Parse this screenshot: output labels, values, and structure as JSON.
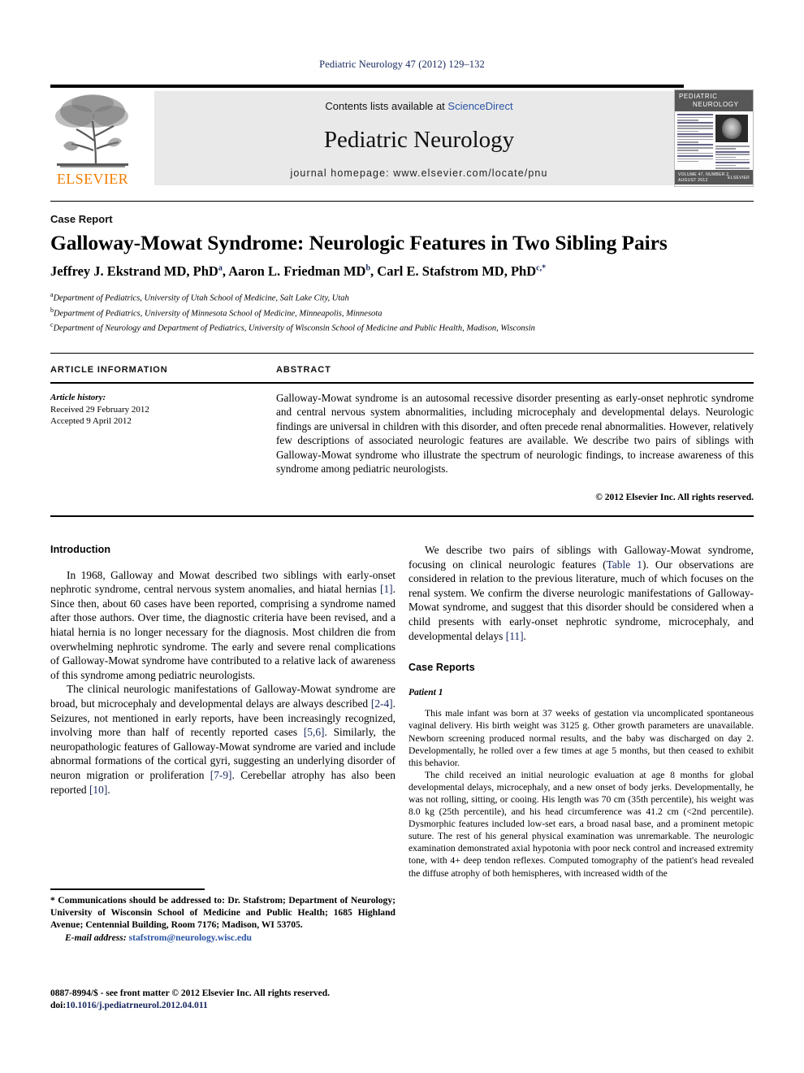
{
  "running_head": "Pediatric Neurology 47 (2012) 129–132",
  "masthead": {
    "contents_prefix": "Contents lists available at ",
    "sciencedirect": "ScienceDirect",
    "journal_title": "Pediatric Neurology",
    "homepage": "journal homepage: www.elsevier.com/locate/pnu",
    "publisher_logo_text": "ELSEVIER",
    "cover": {
      "title_line1": "PEDIATRIC",
      "title_line2": "NEUROLOGY",
      "footer_line1": "VOLUME 47, NUMBER 2",
      "footer_line2": "AUGUST 2012",
      "footer_right": "ELSEVIER"
    }
  },
  "article": {
    "kind": "Case Report",
    "title": "Galloway-Mowat Syndrome: Neurologic Features in Two Sibling Pairs",
    "authors": [
      {
        "name": "Jeffrey J. Ekstrand MD, PhD",
        "sup": "a",
        "sep": ", "
      },
      {
        "name": "Aaron L. Friedman MD",
        "sup": "b",
        "sep": ", "
      },
      {
        "name": "Carl E. Stafstrom MD, PhD",
        "sup": "c,*",
        "sep": ""
      }
    ],
    "affiliations": [
      {
        "mark": "a",
        "text": "Department of Pediatrics, University of Utah School of Medicine, Salt Lake City, Utah"
      },
      {
        "mark": "b",
        "text": "Department of Pediatrics, University of Minnesota School of Medicine, Minneapolis, Minnesota"
      },
      {
        "mark": "c",
        "text": "Department of Neurology and Department of Pediatrics, University of Wisconsin School of Medicine and Public Health, Madison, Wisconsin"
      }
    ]
  },
  "info": {
    "heading": "ARTICLE INFORMATION",
    "history_label": "Article history:",
    "received": "Received 29 February 2012",
    "accepted": "Accepted 9 April 2012"
  },
  "abstract": {
    "heading": "ABSTRACT",
    "body": "Galloway-Mowat syndrome is an autosomal recessive disorder presenting as early-onset nephrotic syndrome and central nervous system abnormalities, including microcephaly and developmental delays. Neurologic findings are universal in children with this disorder, and often precede renal abnormalities. However, relatively few descriptions of associated neurologic features are available. We describe two pairs of siblings with Galloway-Mowat syndrome who illustrate the spectrum of neurologic findings, to increase awareness of this syndrome among pediatric neurologists.",
    "copyright": "© 2012 Elsevier Inc. All rights reserved."
  },
  "left_column": {
    "heading": "Introduction",
    "paragraph_1_a": "In 1968, Galloway and Mowat described two siblings with early-onset nephrotic syndrome, central nervous system anomalies, and hiatal hernias ",
    "paragraph_1_ref": "[1]",
    "paragraph_1_b": ". Since then, about 60 cases have been reported, comprising a syndrome named after those authors. Over time, the diagnostic criteria have been revised, and a hiatal hernia is no longer necessary for the diagnosis. Most children die from overwhelming nephrotic syndrome. The early and severe renal complications of Galloway-Mowat syndrome have contributed to a relative lack of awareness of this syndrome among pediatric neurologists.",
    "paragraph_2_a": "The clinical neurologic manifestations of Galloway-Mowat syndrome are broad, but microcephaly and developmental delays are always described ",
    "paragraph_2_ref1": "[2-4]",
    "paragraph_2_b": ". Seizures, not mentioned in early reports, have been increasingly recognized, involving more than half of recently reported cases ",
    "paragraph_2_ref2": "[5,6]",
    "paragraph_2_c": ". Similarly, the neuropathologic features of Galloway-Mowat syndrome are varied and include abnormal formations of the cortical gyri, suggesting an underlying disorder of neuron migration or proliferation ",
    "paragraph_2_ref3": "[7-9]",
    "paragraph_2_d": ". Cerebellar atrophy has also been reported ",
    "paragraph_2_ref4": "[10]",
    "paragraph_2_e": "."
  },
  "right_column": {
    "paragraph_1_a": "We describe two pairs of siblings with Galloway-Mowat syndrome, focusing on clinical neurologic features (",
    "paragraph_1_ref1": "Table 1",
    "paragraph_1_b": "). Our observations are considered in relation to the previous literature, much of which focuses on the renal system. We confirm the diverse neurologic manifestations of Galloway-Mowat syndrome, and suggest that this disorder should be considered when a child presents with early-onset nephrotic syndrome, microcephaly, and developmental delays ",
    "paragraph_1_ref2": "[11]",
    "paragraph_1_c": ".",
    "heading": "Case Reports",
    "patient_heading": "Patient 1",
    "patient_paragraph_1": "This male infant was born at 37 weeks of gestation via uncomplicated spontaneous vaginal delivery. His birth weight was 3125 g. Other growth parameters are unavailable. Newborn screening produced normal results, and the baby was discharged on day 2. Developmentally, he rolled over a few times at age 5 months, but then ceased to exhibit this behavior.",
    "patient_paragraph_2": "The child received an initial neurologic evaluation at age 8 months for global developmental delays, microcephaly, and a new onset of body jerks. Developmentally, he was not rolling, sitting, or cooing. His length was 70 cm (35th percentile), his weight was 8.0 kg (25th percentile), and his head circumference was 41.2 cm (<2nd percentile). Dysmorphic features included low-set ears, a broad nasal base, and a prominent metopic suture. The rest of his general physical examination was unremarkable. The neurologic examination demonstrated axial hypotonia with poor neck control and increased extremity tone, with 4+ deep tendon reflexes. Computed tomography of the patient's head revealed the diffuse atrophy of both hemispheres, with increased width of the"
  },
  "footnote": {
    "text": "* Communications should be addressed to: Dr. Stafstrom; Department of Neurology; University of Wisconsin School of Medicine and Public Health; 1685 Highland Avenue; Centennial Building, Room 7176; Madison, WI 53705.",
    "email_label": "E-mail address:",
    "email": "stafstrom@neurology.wisc.edu"
  },
  "issn": {
    "line1": "0887-8994/$ - see front matter © 2012 Elsevier Inc. All rights reserved.",
    "doi_label": "doi:",
    "doi": "10.1016/j.pediatrneurol.2012.04.011"
  },
  "colors": {
    "link": "#2b54a4",
    "reference": "#16265c",
    "elsevier_orange": "#f07d00",
    "banner_gray": "#e9e9e9"
  }
}
